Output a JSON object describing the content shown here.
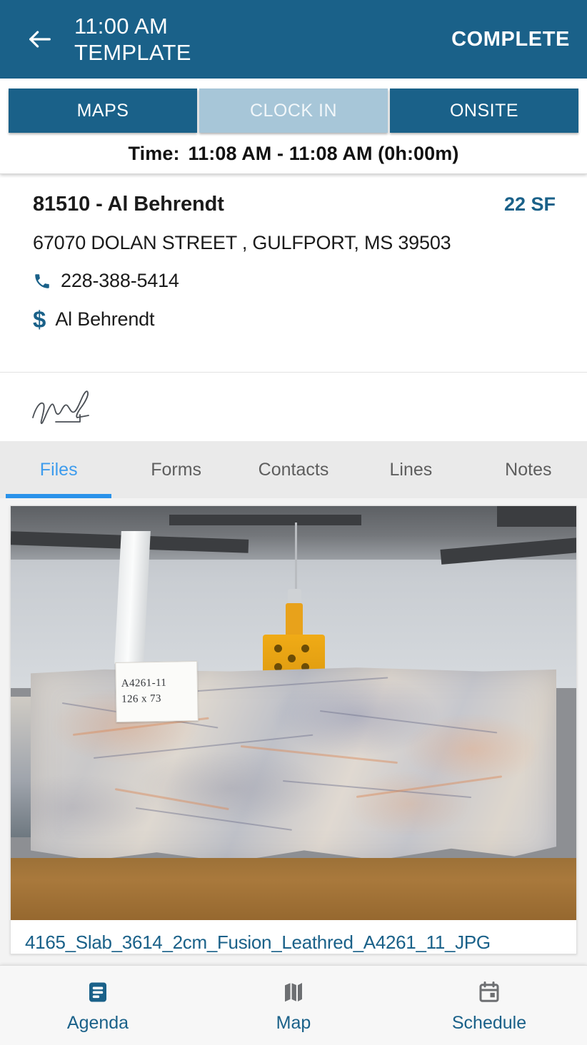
{
  "header": {
    "back_icon": "arrow-left-icon",
    "title_line1": "11:00 AM",
    "title_line2": "TEMPLATE",
    "action_label": "COMPLETE",
    "background_color": "#1a6189"
  },
  "actionbar": {
    "buttons": [
      {
        "label": "MAPS",
        "state": "enabled",
        "color": "#1a6189"
      },
      {
        "label": "CLOCK IN",
        "state": "disabled",
        "color": "#a7c6d8"
      },
      {
        "label": "ONSITE",
        "state": "enabled",
        "color": "#1a6189"
      }
    ],
    "time_label": "Time:",
    "time_value": "11:08 AM - 11:08 AM (0h:00m)"
  },
  "job": {
    "title": "81510 - Al Behrendt",
    "square_feet": "22 SF",
    "address": "67070 DOLAN STREET , GULFPORT, MS 39503",
    "phone_icon": "phone-icon",
    "phone": "228-388-5414",
    "money_icon": "dollar-icon",
    "billing_contact": "Al Behrendt",
    "accent_color": "#1a6189"
  },
  "signature": {
    "name": "customer-signature",
    "ink_color": "#4a4f55"
  },
  "tabs": {
    "active_index": 0,
    "active_color": "#2a92ea",
    "items": [
      {
        "label": "Files"
      },
      {
        "label": "Forms"
      },
      {
        "label": "Contacts"
      },
      {
        "label": "Lines"
      },
      {
        "label": "Notes"
      }
    ]
  },
  "files": {
    "photo": {
      "name": "slab-photo",
      "tag_line1": "A4261-11",
      "tag_line2": "126 x 73"
    },
    "filename": "4165_Slab_3614_2cm_Fusion_Leathred_A4261_11_JPG"
  },
  "bottomnav": {
    "items": [
      {
        "label": "Agenda",
        "icon": "agenda-icon",
        "active": true
      },
      {
        "label": "Map",
        "icon": "map-icon",
        "active": false
      },
      {
        "label": "Schedule",
        "icon": "calendar-icon",
        "active": false
      }
    ],
    "active_color": "#1a6189",
    "inactive_icon_color": "#6d6f72"
  }
}
